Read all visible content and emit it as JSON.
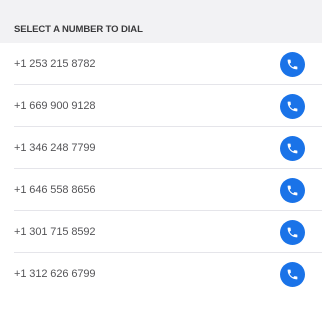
{
  "header": {
    "title": "SELECT A NUMBER TO DIAL"
  },
  "numbers": [
    {
      "label": "+1 253 215 8782",
      "action_icon": "phone-icon"
    },
    {
      "label": "+1 669 900 9128",
      "action_icon": "phone-icon"
    },
    {
      "label": "+1 346 248 7799",
      "action_icon": "phone-icon"
    },
    {
      "label": "+1 646 558 8656",
      "action_icon": "phone-icon"
    },
    {
      "label": "+1 301 715 8592",
      "action_icon": "phone-icon"
    },
    {
      "label": "+1 312 626 6799",
      "action_icon": "phone-icon"
    }
  ],
  "colors": {
    "accent": "#1a73e8",
    "header_background": "#f2f2f4",
    "separator": "#e5e5ea"
  }
}
